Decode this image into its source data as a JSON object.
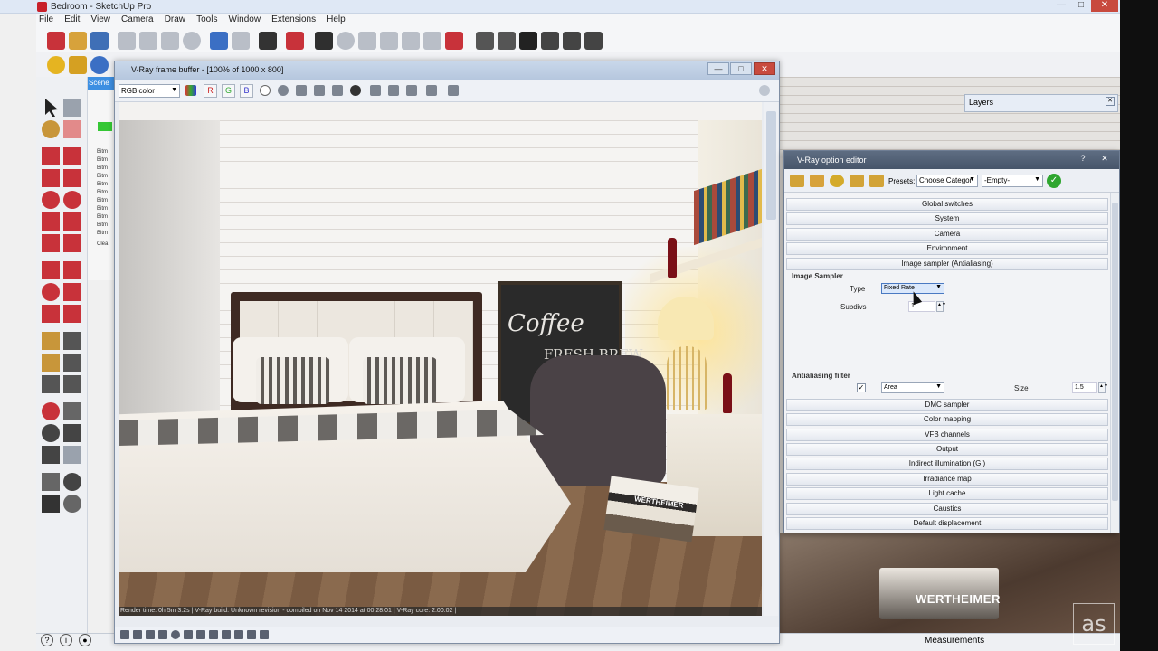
{
  "app": {
    "title": "Bedroom - SketchUp Pro",
    "menu": [
      "File",
      "Edit",
      "View",
      "Camera",
      "Draw",
      "Tools",
      "Window",
      "Extensions",
      "Help"
    ]
  },
  "scenes_panel": {
    "tab": "Scene",
    "items": [
      "Bitm",
      "Bitm",
      "Bitm",
      "Bitm",
      "Bitm",
      "Bitm",
      "Bitm",
      "Bitm",
      "Bitm",
      "Bitm",
      "Bitm",
      "Clea"
    ]
  },
  "vfb": {
    "title": "V-Ray frame buffer - [100% of 1000 x 800]",
    "channel": "RGB color",
    "channel_buttons": [
      "R",
      "G",
      "B"
    ],
    "status": "Render time:  0h  5m  3.2s | V-Ray build: Unknown revision - compiled on Nov 14 2014 at 00:28:01 | V-Ray core: 2.00.02 |",
    "scene_text": {
      "board_main": "Coffee",
      "board_sub": "FRESH BREW",
      "books_label": "WERTHEIMER"
    }
  },
  "layers": {
    "title": "Layers"
  },
  "option_editor": {
    "title": "V-Ray option editor",
    "help": "?",
    "presets_label": "Presets:",
    "preset_category": "Choose Categor",
    "preset_value": "-Empty-",
    "sections_top": [
      "Global switches",
      "System",
      "Camera",
      "Environment",
      "Image sampler (Antialiasing)"
    ],
    "image_sampler": {
      "heading": "Image Sampler",
      "type_label": "Type",
      "type_value": "Fixed Rate",
      "subdivs_label": "Subdivs",
      "subdivs_value": "1"
    },
    "aa_filter": {
      "heading": "Antialiasing filter",
      "enabled": true,
      "filter_value": "Area",
      "size_label": "Size",
      "size_value": "1.5"
    },
    "sections_bottom": [
      "DMC sampler",
      "Color mapping",
      "VFB channels",
      "Output",
      "Indirect illumination (GI)",
      "Irradiance map",
      "Light cache",
      "Caustics",
      "Default displacement"
    ]
  },
  "viewport": {
    "books_label": "WERTHEIMER"
  },
  "statusbar": {
    "measurements": "Measurements"
  },
  "watermark": {
    "text": "as"
  },
  "colors": {
    "accent_blue": "#3d8fe2",
    "vray_ok": "#2fa62f",
    "title_dark": "#47556a"
  }
}
